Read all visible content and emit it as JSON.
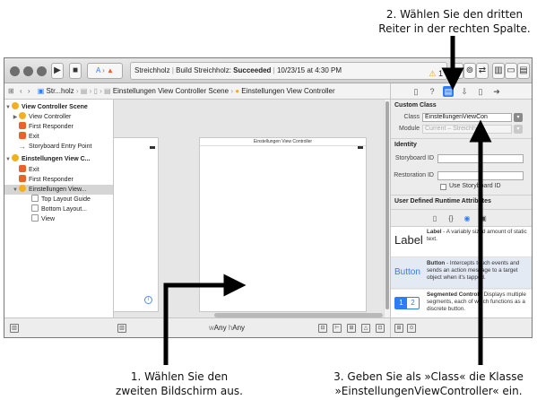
{
  "callouts": {
    "step1_line1": "1. Wählen Sie den",
    "step1_line2": "zweiten Bildschirm aus.",
    "step2_line1": "2. Wählen Sie den dritten",
    "step2_line2": "Reiter in der rechten Spalte.",
    "step3_line1": "3. Geben Sie als »Class« die Klasse",
    "step3_line2": "»EinstellungenViewController« ein."
  },
  "toolbar": {
    "scheme": "Streichholz",
    "build_prefix": "Build Streichholz:",
    "build_status": "Succeeded",
    "timestamp": "10/23/15 at 4:30 PM",
    "warning_count": "1"
  },
  "jumpbar": {
    "crumb1": "Str...holz",
    "crumb2": "Einstellungen View Controller Scene",
    "crumb3": "Einstellungen View Controller"
  },
  "outline": {
    "scene1_title": "View Controller Scene",
    "scene1_items": [
      "View Controller",
      "First Responder",
      "Exit",
      "Storyboard Entry Point"
    ],
    "scene2_title": "Einstellungen View C...",
    "scene2_items": [
      "Exit",
      "First Responder",
      "Einstellungen View..."
    ],
    "scene2_children": [
      "Top Layout Guide",
      "Bottom Layout...",
      "View"
    ]
  },
  "canvas": {
    "scene2_caption": "Einstellungen View Controller",
    "size_w": "w",
    "size_any1": "Any",
    "size_h": "h",
    "size_any2": "Any"
  },
  "inspector": {
    "custom_class_header": "Custom Class",
    "class_label": "Class",
    "class_value": "EinstellungenViewCon",
    "module_label": "Module",
    "module_value": "Current – Streichholz",
    "identity_header": "Identity",
    "storyboard_id_label": "Storyboard ID",
    "restoration_id_label": "Restoration ID",
    "use_storyboard_id": "Use Storyboard ID",
    "runtime_attributes_header": "User Defined Runtime Attributes"
  },
  "library": [
    {
      "icon_text": "Label",
      "title": "Label",
      "desc": " - A variably sized amount of static text."
    },
    {
      "icon_text": "Button",
      "title": "Button",
      "desc": " - Intercepts touch events and sends an action message to a target object when it's tapped."
    },
    {
      "icon_text": "12",
      "title": "Segmented Control",
      "desc": " - Displays multiple segments, each of which functions as a discrete button."
    }
  ],
  "colors": {
    "accent": "#2f7df6",
    "scene_icon": "#f2b01e",
    "responder_icon": "#e8622a",
    "warning": "#e2a300"
  }
}
